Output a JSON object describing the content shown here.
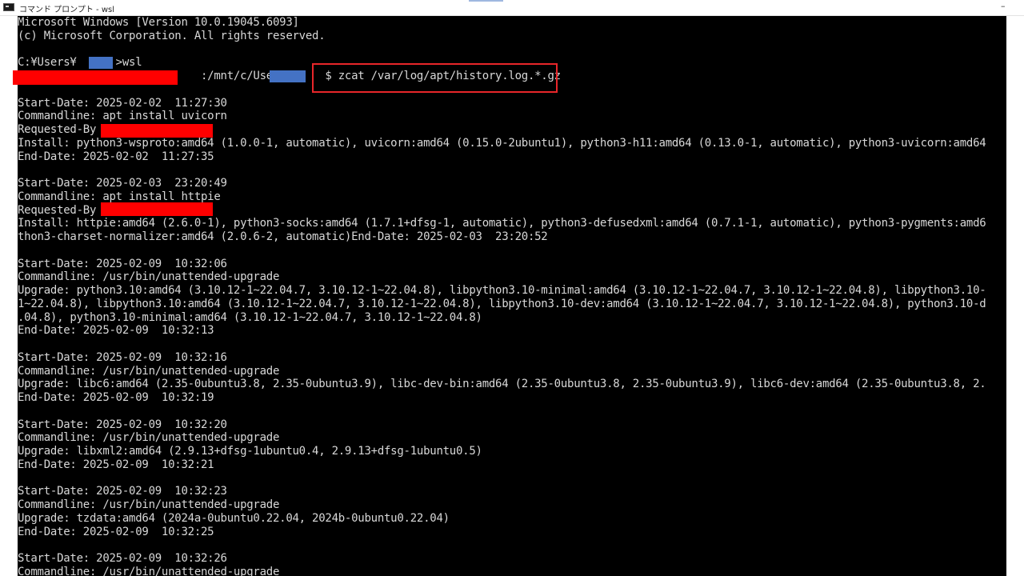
{
  "window": {
    "title": "コマンド プロンプト - wsl",
    "minimize_glyph": "–"
  },
  "console": {
    "lines": [
      "Microsoft Windows [Version 10.0.19045.6093]",
      "(c) Microsoft Corporation. All rights reserved.",
      "",
      "C:¥Users¥      >wsl",
      "                            :/mnt/c/Users/     $ zcat /var/log/apt/history.log.*.gz",
      "",
      "Start-Date: 2025-02-02  11:27:30",
      "Commandline: apt install uvicorn",
      "Requested-By",
      "Install: python3-wsproto:amd64 (1.0.0-1, automatic), uvicorn:amd64 (0.15.0-2ubuntu1), python3-h11:amd64 (0.13.0-1, automatic), python3-uvicorn:amd64",
      "End-Date: 2025-02-02  11:27:35",
      "",
      "Start-Date: 2025-02-03  23:20:49",
      "Commandline: apt install httpie",
      "Requested-By",
      "Install: httpie:amd64 (2.6.0-1), python3-socks:amd64 (1.7.1+dfsg-1, automatic), python3-defusedxml:amd64 (0.7.1-1, automatic), python3-pygments:amd6",
      "thon3-charset-normalizer:amd64 (2.0.6-2, automatic)End-Date: 2025-02-03  23:20:52",
      "",
      "Start-Date: 2025-02-09  10:32:06",
      "Commandline: /usr/bin/unattended-upgrade",
      "Upgrade: python3.10:amd64 (3.10.12-1~22.04.7, 3.10.12-1~22.04.8), libpython3.10-minimal:amd64 (3.10.12-1~22.04.7, 3.10.12-1~22.04.8), libpython3.10-",
      "1~22.04.8), libpython3.10:amd64 (3.10.12-1~22.04.7, 3.10.12-1~22.04.8), libpython3.10-dev:amd64 (3.10.12-1~22.04.7, 3.10.12-1~22.04.8), python3.10-d",
      ".04.8), python3.10-minimal:amd64 (3.10.12-1~22.04.7, 3.10.12-1~22.04.8)",
      "End-Date: 2025-02-09  10:32:13",
      "",
      "Start-Date: 2025-02-09  10:32:16",
      "Commandline: /usr/bin/unattended-upgrade",
      "Upgrade: libc6:amd64 (2.35-0ubuntu3.8, 2.35-0ubuntu3.9), libc-dev-bin:amd64 (2.35-0ubuntu3.8, 2.35-0ubuntu3.9), libc6-dev:amd64 (2.35-0ubuntu3.8, 2.",
      "End-Date: 2025-02-09  10:32:19",
      "",
      "Start-Date: 2025-02-09  10:32:20",
      "Commandline: /usr/bin/unattended-upgrade",
      "Upgrade: libxml2:amd64 (2.9.13+dfsg-1ubuntu0.4, 2.9.13+dfsg-1ubuntu0.5)",
      "End-Date: 2025-02-09  10:32:21",
      "",
      "Start-Date: 2025-02-09  10:32:23",
      "Commandline: /usr/bin/unattended-upgrade",
      "Upgrade: tzdata:amd64 (2024a-0ubuntu0.22.04, 2024b-0ubuntu0.22.04)",
      "End-Date: 2025-02-09  10:32:25",
      "",
      "Start-Date: 2025-02-09  10:32:26",
      "Commandline: /usr/bin/unattended-upgrade"
    ]
  },
  "colors": {
    "console_bg": "#000000",
    "console_text": "#d8d8d8",
    "redaction": "#ff0000",
    "username_mask": "#4472c4",
    "highlight_border": "#e8262a"
  }
}
